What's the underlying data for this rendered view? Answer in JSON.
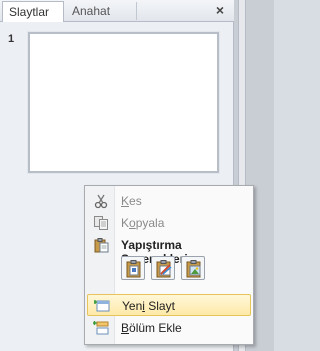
{
  "panel": {
    "tabs": [
      {
        "label": "Slaytlar",
        "active": true
      },
      {
        "label": "Anahat",
        "active": false
      }
    ],
    "close_glyph": "×"
  },
  "slides": [
    {
      "number": "1"
    }
  ],
  "context_menu": {
    "cut": {
      "label_prefix": "",
      "label_u": "K",
      "label_rest": "es",
      "icon": "scissors-icon",
      "enabled": false
    },
    "copy": {
      "label_prefix": "K",
      "label_u": "o",
      "label_rest": "pyala",
      "icon": "copy-icon",
      "enabled": false
    },
    "paste_options": {
      "label": "Yapıştırma Seçenekleri:",
      "icon": "clipboard-icon",
      "buttons": [
        {
          "name": "paste-keep-source-button",
          "icon": "paste-source-icon"
        },
        {
          "name": "paste-use-theme-button",
          "icon": "paste-theme-icon"
        },
        {
          "name": "paste-picture-button",
          "icon": "paste-picture-icon"
        }
      ]
    },
    "new_slide": {
      "label_prefix": "Yen",
      "label_u": "i",
      "label_rest": " Slayt",
      "icon": "new-slide-icon",
      "highlighted": true
    },
    "add_section": {
      "label_prefix": "",
      "label_u": "B",
      "label_rest": "ölüm Ekle",
      "icon": "add-section-icon"
    }
  },
  "colors": {
    "highlight": "#fde9a8",
    "pane_bg": "#eceff3"
  }
}
